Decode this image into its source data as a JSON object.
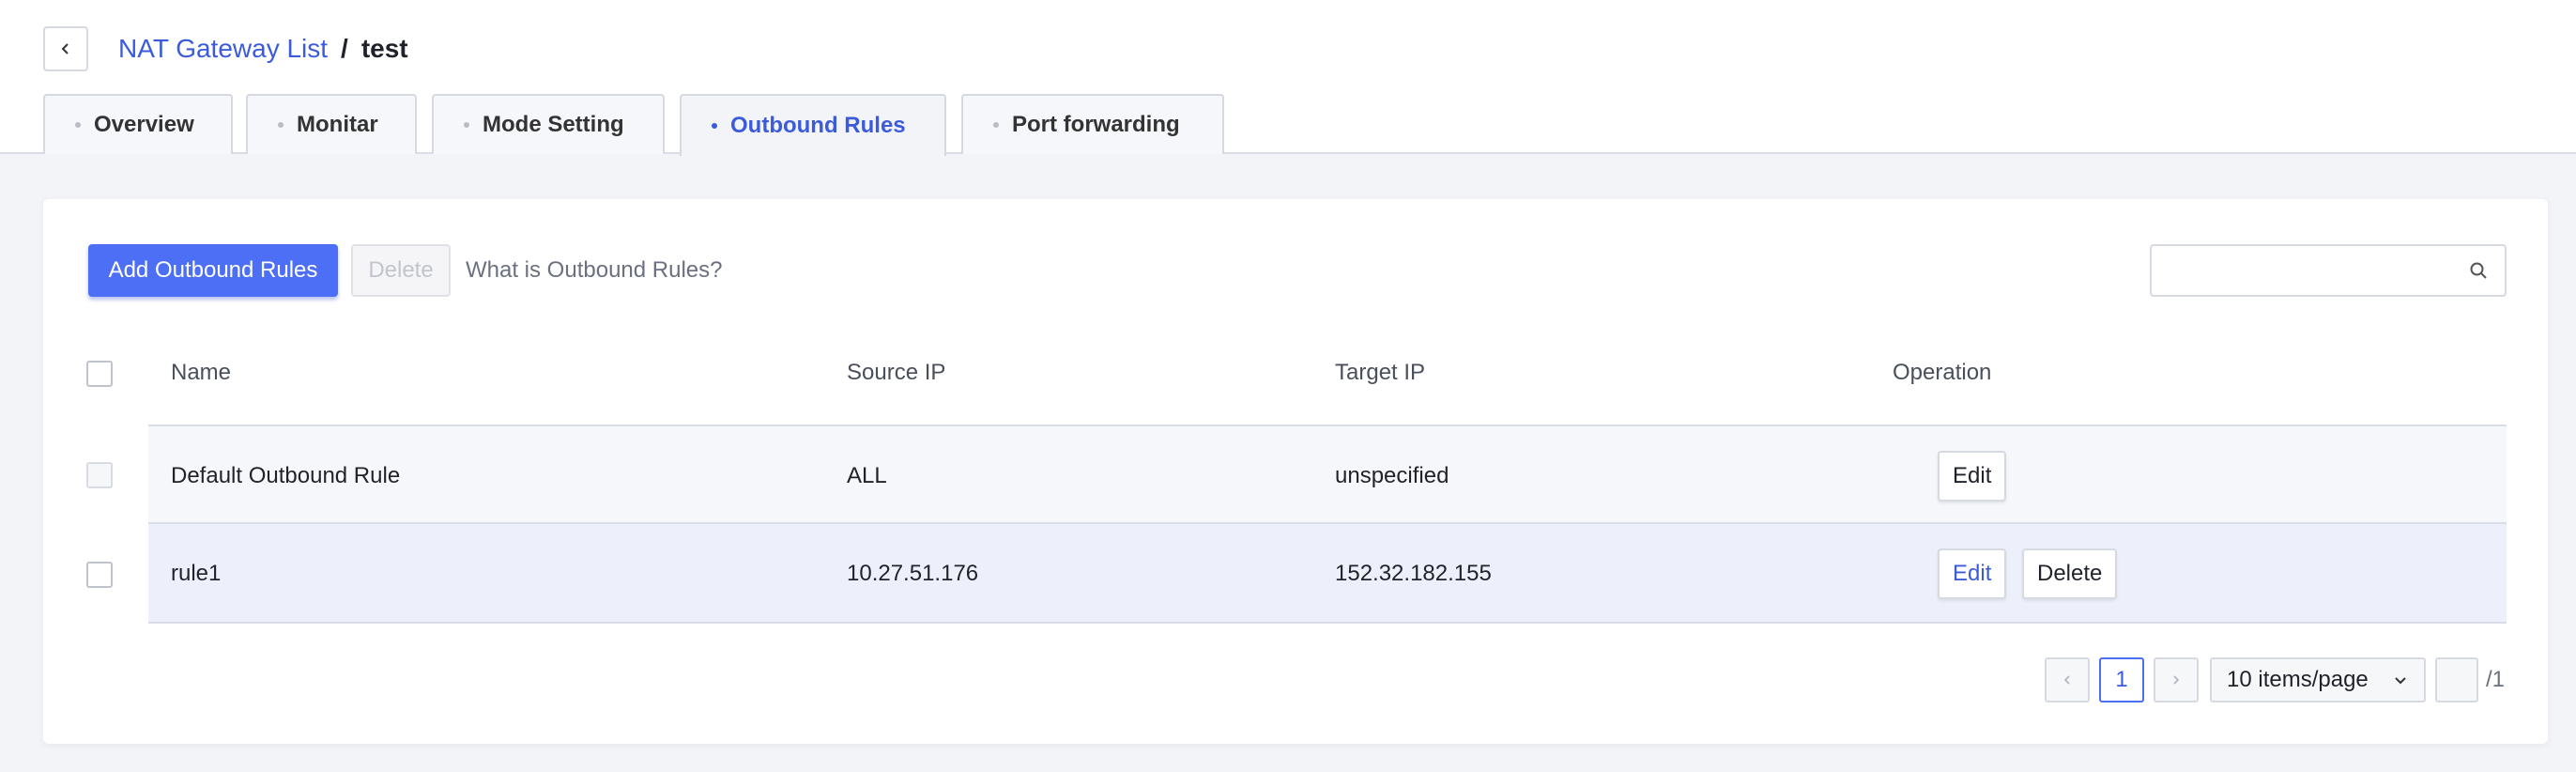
{
  "breadcrumb": {
    "parent": "NAT Gateway List",
    "separator": "/",
    "current": "test"
  },
  "tabs": [
    {
      "label": "Overview",
      "active": false
    },
    {
      "label": "Monitar",
      "active": false
    },
    {
      "label": "Mode Setting",
      "active": false
    },
    {
      "label": "Outbound Rules",
      "active": true
    },
    {
      "label": "Port forwarding",
      "active": false
    }
  ],
  "toolbar": {
    "add_label": "Add Outbound Rules",
    "delete_label": "Delete",
    "help_label": "What is Outbound Rules?",
    "search_placeholder": ""
  },
  "table": {
    "columns": [
      "Name",
      "Source IP",
      "Target IP",
      "Operation"
    ],
    "rows": [
      {
        "name": "Default Outbound Rule",
        "source_ip": "ALL",
        "target_ip": "unspecified",
        "ops": [
          "Edit"
        ]
      },
      {
        "name": "rule1",
        "source_ip": "10.27.51.176",
        "target_ip": "152.32.182.155",
        "ops": [
          "Edit",
          "Delete"
        ]
      }
    ]
  },
  "pagination": {
    "current_page": "1",
    "page_size": "10 items/page",
    "jump_value": "",
    "total": "/1"
  },
  "colors": {
    "accent": "#4d6ff5",
    "link": "#3b5bdb",
    "selected_row": "#edf0fb"
  },
  "icons": {
    "back": "chevron-left-icon",
    "search": "search-icon",
    "prev": "chevron-left-icon",
    "next": "chevron-right-icon",
    "dropdown": "chevron-down-icon"
  }
}
